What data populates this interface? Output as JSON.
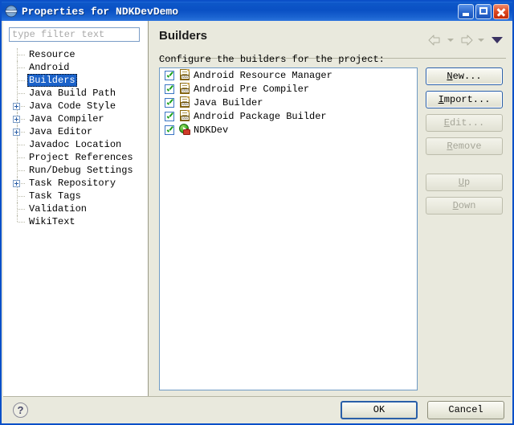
{
  "window": {
    "title": "Properties for NDKDevDemo",
    "icon": "eclipse-globe-icon",
    "buttons": {
      "minimize": "minimize-button",
      "maximize": "maximize-button",
      "close": "close-button"
    }
  },
  "sidebar": {
    "filter_placeholder": "type filter text",
    "filter_value": "",
    "items": [
      {
        "label": "Resource",
        "expandable": false,
        "selected": false
      },
      {
        "label": "Android",
        "expandable": false,
        "selected": false
      },
      {
        "label": "Builders",
        "expandable": false,
        "selected": true
      },
      {
        "label": "Java Build Path",
        "expandable": false,
        "selected": false
      },
      {
        "label": "Java Code Style",
        "expandable": true,
        "selected": false
      },
      {
        "label": "Java Compiler",
        "expandable": true,
        "selected": false
      },
      {
        "label": "Java Editor",
        "expandable": true,
        "selected": false
      },
      {
        "label": "Javadoc Location",
        "expandable": false,
        "selected": false
      },
      {
        "label": "Project References",
        "expandable": false,
        "selected": false
      },
      {
        "label": "Run/Debug Settings",
        "expandable": false,
        "selected": false
      },
      {
        "label": "Task Repository",
        "expandable": true,
        "selected": false
      },
      {
        "label": "Task Tags",
        "expandable": false,
        "selected": false
      },
      {
        "label": "Validation",
        "expandable": false,
        "selected": false
      },
      {
        "label": "WikiText",
        "expandable": false,
        "selected": false
      }
    ]
  },
  "page": {
    "title": "Builders",
    "description": "Configure the builders for the project:",
    "nav": {
      "back": "back-arrow",
      "back_caret": "back-dropdown-caret",
      "forward": "forward-arrow",
      "forward_caret": "forward-dropdown-caret",
      "menu": "view-menu-triangle"
    }
  },
  "builders": [
    {
      "label": "Android Resource Manager",
      "checked": true,
      "icon": "builder-doc-icon",
      "icon_text": "010"
    },
    {
      "label": "Android Pre Compiler",
      "checked": true,
      "icon": "builder-doc-icon",
      "icon_text": "010"
    },
    {
      "label": "Java Builder",
      "checked": true,
      "icon": "builder-doc-icon",
      "icon_text": "010"
    },
    {
      "label": "Android Package Builder",
      "checked": true,
      "icon": "builder-doc-icon",
      "icon_text": "010"
    },
    {
      "label": "NDKDev",
      "checked": true,
      "icon": "builder-run-icon",
      "icon_text": ""
    }
  ],
  "side_buttons": [
    {
      "label": "New...",
      "mnemonic": "N",
      "enabled": true,
      "focused": true
    },
    {
      "label": "Import...",
      "mnemonic": "I",
      "enabled": true,
      "focused": true
    },
    {
      "label": "Edit...",
      "mnemonic": "E",
      "enabled": false,
      "focused": false
    },
    {
      "label": "Remove",
      "mnemonic": "R",
      "enabled": false,
      "focused": false
    },
    {
      "label": "Up",
      "mnemonic": "U",
      "enabled": false,
      "focused": false
    },
    {
      "label": "Down",
      "mnemonic": "D",
      "enabled": false,
      "focused": false
    }
  ],
  "footer": {
    "help": "?",
    "ok": "OK",
    "cancel": "Cancel"
  },
  "colors": {
    "titlebar": "#0a50c4",
    "dialog_bg": "#e9e9dd",
    "panel_bg": "#ffffff",
    "selection": "#1b62c9",
    "list_border": "#6f9ac4",
    "checkmark": "#1aa01a"
  }
}
